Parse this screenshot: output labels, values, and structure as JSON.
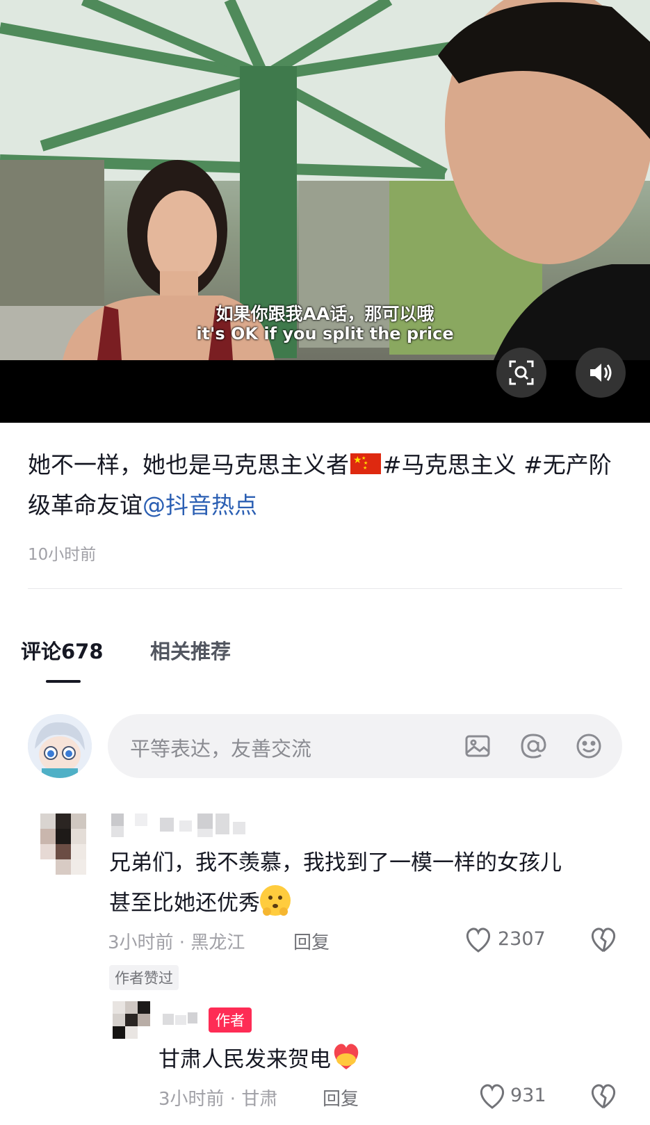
{
  "video": {
    "subtitle_cn": "如果你跟我AA话，那可以哦",
    "subtitle_en": "it's OK if you split the price"
  },
  "post": {
    "caption_text": "她不一样，她也是马克思主义者",
    "hashtags": "#马克思主义 #无产阶级革命友谊",
    "mention": "@抖音热点",
    "time": "10小时前"
  },
  "tabs": [
    {
      "label": "评论678",
      "active": true
    },
    {
      "label": "相关推荐",
      "active": false
    }
  ],
  "comment_input": {
    "placeholder": "平等表达，友善交流"
  },
  "comments": [
    {
      "text_line1": "兄弟们，我不羡慕，我找到了一模一样的女孩儿",
      "text_line2": "甚至比她还优秀",
      "time_location": "3小时前 · 黑龙江",
      "reply_label": "回复",
      "likes": "2307",
      "badge": "作者赞过"
    },
    {
      "author_badge": "作者",
      "text": "甘肃人民发来贺电",
      "time_location": "3小时前 · 甘肃",
      "reply_label": "回复",
      "likes": "931"
    }
  ],
  "colors": {
    "accent": "#fe2c55",
    "mention": "#2b5fb3",
    "flag": "#de2910"
  },
  "icons": [
    "scan-icon",
    "volume-icon",
    "image-icon",
    "at-icon",
    "emoji-icon",
    "heart-icon",
    "broken-heart-icon"
  ]
}
